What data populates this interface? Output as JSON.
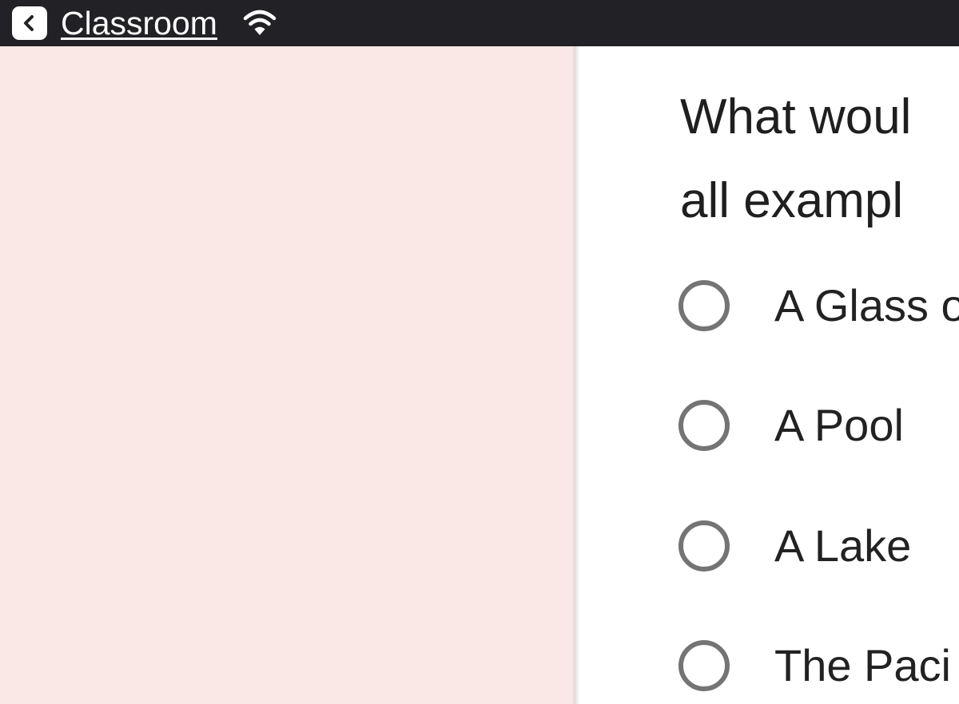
{
  "status_bar": {
    "back_label": "Classroom",
    "back_icon": "chevron-left-icon",
    "wifi_icon": "wifi-icon"
  },
  "colors": {
    "status_bar_bg": "#222125",
    "left_panel_bg": "#fae8e7",
    "content_bg": "#ffffff",
    "radio_border": "#747474",
    "text": "#1f1f1f"
  },
  "question": {
    "text": "What woul\nall exampl"
  },
  "options": [
    {
      "label": "A Glass o",
      "selected": false
    },
    {
      "label": "A Pool",
      "selected": false
    },
    {
      "label": "A Lake",
      "selected": false
    },
    {
      "label": "The Paci",
      "selected": false
    }
  ]
}
